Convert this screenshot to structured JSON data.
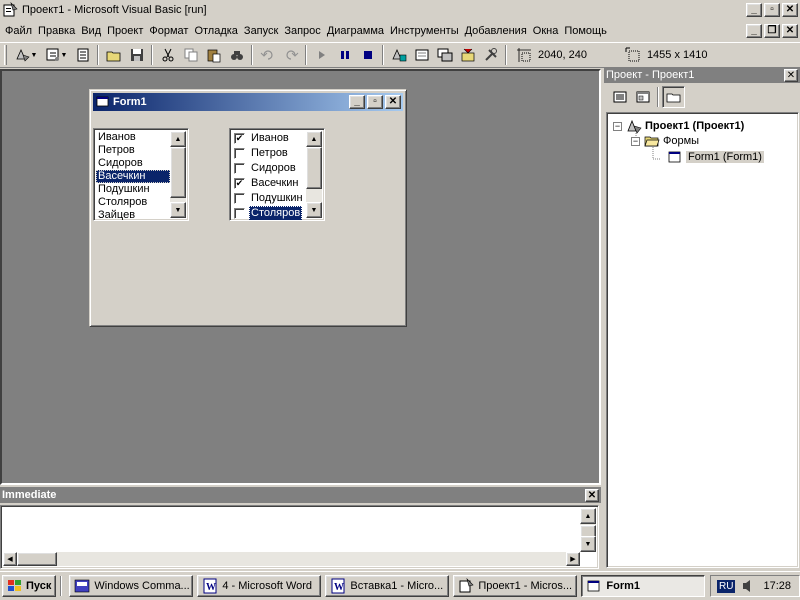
{
  "window": {
    "title": "Проект1 - Microsoft Visual Basic [run]"
  },
  "menu": [
    {
      "label": "Файл"
    },
    {
      "label": "Правка"
    },
    {
      "label": "Вид"
    },
    {
      "label": "Проект"
    },
    {
      "label": "Формат"
    },
    {
      "label": "Отладка"
    },
    {
      "label": "Запуск"
    },
    {
      "label": "Запрос"
    },
    {
      "label": "Диаграмма"
    },
    {
      "label": "Инструменты"
    },
    {
      "label": "Добавления"
    },
    {
      "label": "Окна"
    },
    {
      "label": "Помощь"
    }
  ],
  "toolbar": {
    "position_readout": "2040, 240",
    "size_readout": "1455 x 1410"
  },
  "form1": {
    "title": "Form1",
    "listbox": {
      "items": [
        "Иванов",
        "Петров",
        "Сидоров",
        "Васечкин",
        "Подушкин",
        "Столяров",
        "Зайцев"
      ],
      "selected": "Васечкин"
    },
    "checklist": {
      "items": [
        {
          "label": "Иванов",
          "checked": true
        },
        {
          "label": "Петров",
          "checked": false
        },
        {
          "label": "Сидоров",
          "checked": false
        },
        {
          "label": "Васечкин",
          "checked": true
        },
        {
          "label": "Подушкин",
          "checked": false
        },
        {
          "label": "Столяров",
          "checked": true
        }
      ],
      "selected": "Столяров"
    }
  },
  "immediate": {
    "title": "Immediate"
  },
  "project": {
    "title": "Проект - Проект1",
    "tree": {
      "root": "Проект1 (Проект1)",
      "folder": "Формы",
      "form": "Form1 (Form1)"
    }
  },
  "taskbar": {
    "start": "Пуск",
    "buttons": [
      {
        "label": "Windows Comma..."
      },
      {
        "label": "4 - Microsoft Word"
      },
      {
        "label": "Вставка1 - Micro..."
      },
      {
        "label": "Проект1 - Micros..."
      },
      {
        "label": "Form1"
      }
    ],
    "lang": "RU",
    "clock": "17:28"
  }
}
